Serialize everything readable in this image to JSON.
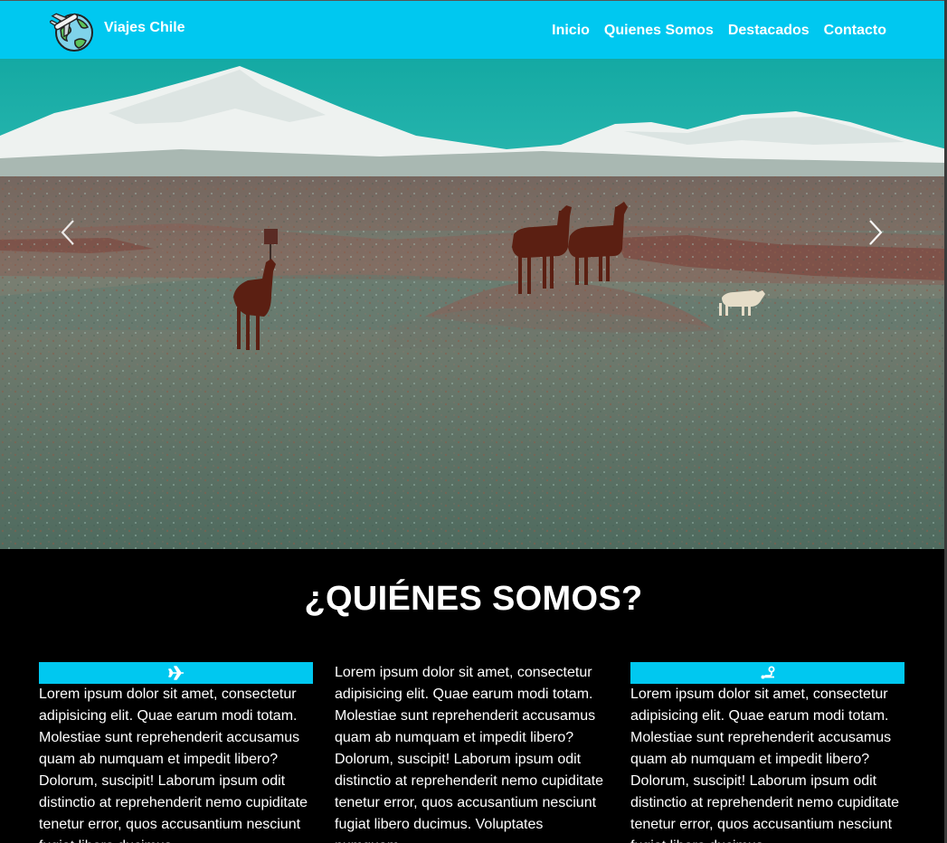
{
  "navbar": {
    "brand_name": "Viajes Chile",
    "links": [
      "Inicio",
      "Quienes Somos",
      "Destacados",
      "Contacto"
    ],
    "background": "#00c8f0"
  },
  "hero": {
    "image": "altiplano-llamas-volcano",
    "prev_icon": "chevron-left-icon",
    "next_icon": "chevron-right-icon"
  },
  "about": {
    "title": "¿QUIÉNES SOMOS?",
    "columns": [
      {
        "icon": "plane-icon",
        "text": "Lorem ipsum dolor sit amet, consectetur adipisicing elit. Quae earum modi totam. Molestiae sunt reprehenderit accusamus quam ab numquam et impedit libero? Dolorum, suscipit! Laborum ipsum odit distinctio at reprehenderit nemo cupiditate tenetur error, quos accusantium nesciunt fugiat libero ducimus."
      },
      {
        "icon": "",
        "text": "Lorem ipsum dolor sit amet, consectetur adipisicing elit. Quae earum modi totam. Molestiae sunt reprehenderit accusamus quam ab numquam et impedit libero? Dolorum, suscipit! Laborum ipsum odit distinctio at reprehenderit nemo cupiditate tenetur error, quos accusantium nesciunt fugiat libero ducimus. Voluptates numquam"
      },
      {
        "icon": "route-icon",
        "text": "Lorem ipsum dolor sit amet, consectetur adipisicing elit. Quae earum modi totam. Molestiae sunt reprehenderit accusamus quam ab numquam et impedit libero? Dolorum, suscipit! Laborum ipsum odit distinctio at reprehenderit nemo cupiditate tenetur error, quos accusantium nesciunt fugiat libero ducimus."
      }
    ],
    "accent": "#00c8f0"
  }
}
